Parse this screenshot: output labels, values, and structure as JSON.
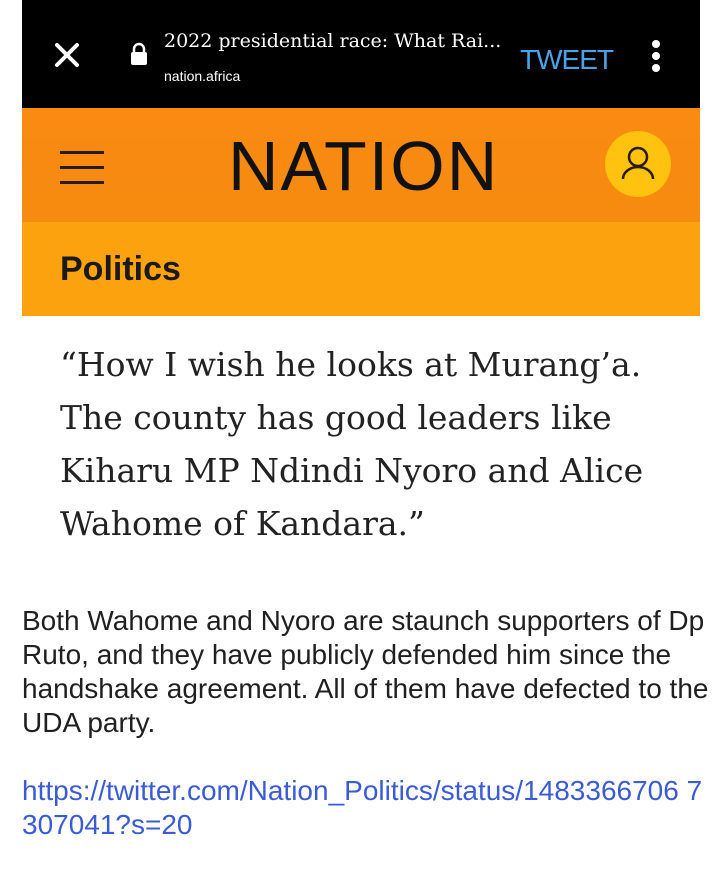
{
  "browser": {
    "close_icon": "close-icon",
    "lock_icon": "lock-icon",
    "page_title": "2022 presidential race: What Rai...",
    "domain": "nation.africa",
    "tweet_label": "TWEET",
    "menu_icon": "more-vert-icon"
  },
  "header": {
    "menu_icon": "hamburger-icon",
    "logo": "NATION",
    "account_icon": "user-icon",
    "brand_color": "#F58B10",
    "accent_color": "#FFC20E"
  },
  "section": {
    "label": "Politics"
  },
  "article": {
    "quote": "“How I wish he looks at Murang’a. The county has good leaders like Kiharu MP Ndindi Nyoro and Alice Wahome of Kandara.”"
  },
  "post": {
    "body": "Both Wahome and Nyoro are staunch supporters of Dp Ruto, and they have publicly defended him since the handshake agreement. All of them have defected to the UDA party.",
    "link": "https://twitter.com/Nation_Politics/status/1483366706 7307041?s=20",
    "link_color": "#3B5BD6"
  }
}
